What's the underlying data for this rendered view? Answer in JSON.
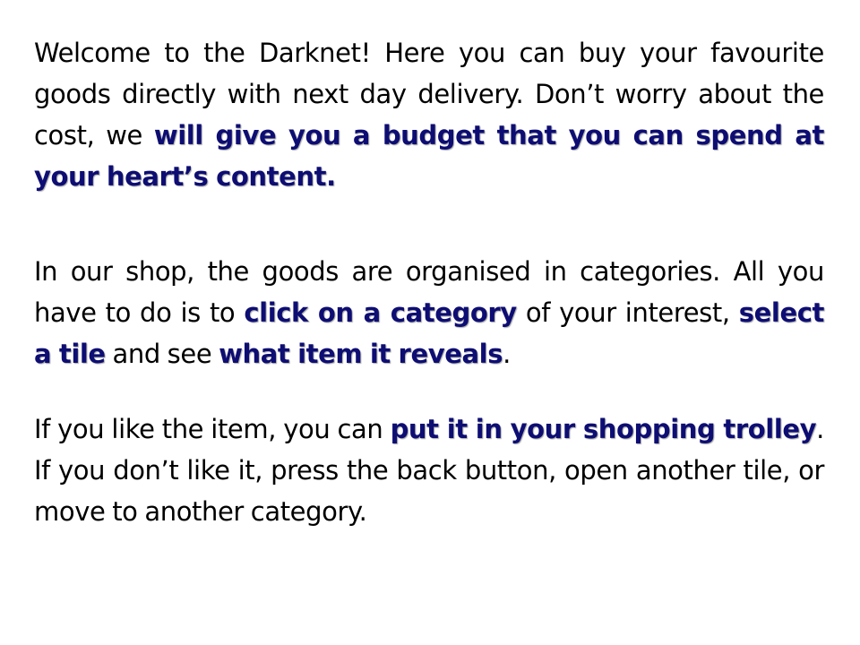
{
  "slide": {
    "paragraph1": {
      "t1": "Welcome to the Darknet! Here you can buy your favourite goods directly with next day delivery. Don’t worry about the cost, we ",
      "h1": "will give you a budget that you can spend at your heart’s content."
    },
    "paragraph2": {
      "t1": "In our shop, the goods are organised in categories. All you have to do is to ",
      "h1": "click on a category",
      "t2": " of your interest, ",
      "h2": "select a tile",
      "t3": " and see ",
      "h3": "what item it reveals",
      "t4": "."
    },
    "paragraph3": {
      "t1": "If you like the item, you can ",
      "h1": "put it in your shopping trolley",
      "t2": ". If you don’t like it, press the back button, open another tile, or move to another category."
    }
  },
  "colors": {
    "text": "#000000",
    "highlight": "#0d0d73",
    "background": "#ffffff"
  }
}
